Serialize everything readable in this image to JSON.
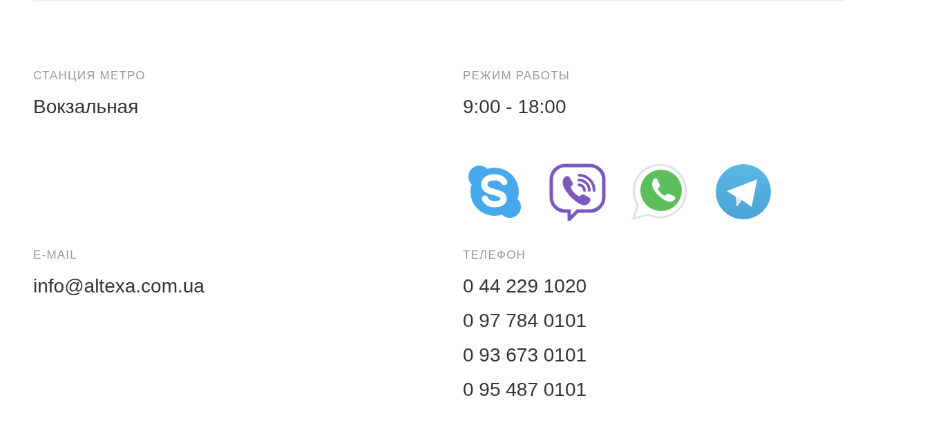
{
  "metro": {
    "label": "СТАНЦИЯ МЕТРО",
    "value": "Вокзальная"
  },
  "hours": {
    "label": "РЕЖИМ РАБОТЫ",
    "value": "9:00 - 18:00"
  },
  "messengers": [
    {
      "kind": "skype"
    },
    {
      "kind": "viber"
    },
    {
      "kind": "whatsapp"
    },
    {
      "kind": "telegram"
    }
  ],
  "email": {
    "label": "E-MAIL",
    "value": "info@altexa.com.ua"
  },
  "phone": {
    "label": "ТЕЛЕФОН",
    "values": [
      "0 44 229 1020",
      "0 97 784 0101",
      "0 93 673 0101",
      "0 95 487 0101"
    ]
  }
}
